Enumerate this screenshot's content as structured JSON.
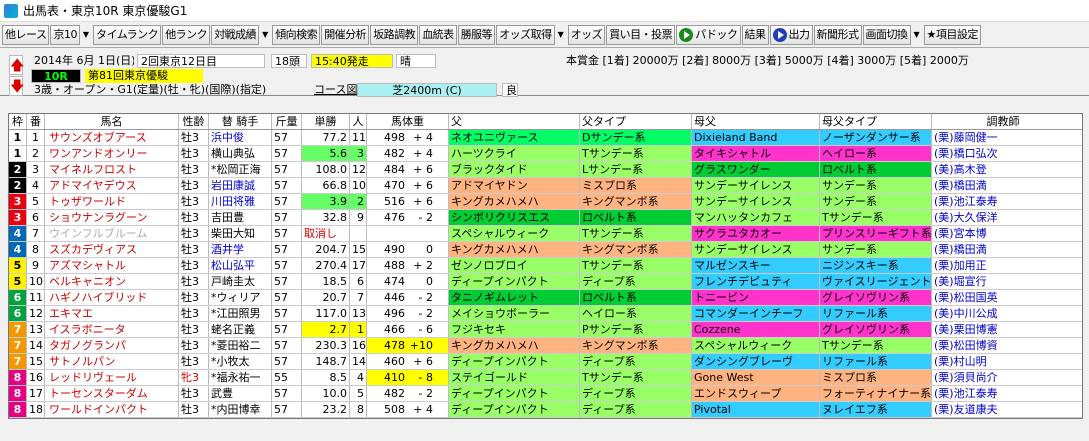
{
  "window": {
    "title": "出馬表・東京10R 東京優駿G1"
  },
  "toolbar": {
    "items": [
      "他レース",
      "京10",
      "タイムランク",
      "他ランク",
      "対戦成績",
      "傾向検索",
      "開催分析",
      "坂路調教",
      "血統表",
      "勝服等",
      "オッズ取得",
      "オッズ",
      "買い目・投票",
      "パドック",
      "結果",
      "出力",
      "新聞形式",
      "画面切換",
      "★項目設定"
    ]
  },
  "race": {
    "date": "2014年 6月 1日(日)",
    "kaisai": "2回東京12日目",
    "heads": "18頭",
    "time": "15:40発走",
    "weather": "晴",
    "race_no": "10R",
    "race_name": "第81回東京優駿",
    "conditions": "3歳・オープン・G1(定量)(牡・牝)(国際)(指定)",
    "course_label": "コース図",
    "course": "芝2400m (C)",
    "going": "良",
    "prize": "本賞金 [1着] 20000万 [2着] 8000万 [3着] 5000万 [4着] 3000万 [5着] 2000万"
  },
  "headers": {
    "waku": "枠",
    "ban": "番",
    "name": "馬名",
    "sex": "性齢",
    "jockey": "替 騎手",
    "weight": "斤量",
    "odds": "単勝",
    "pop": "人",
    "bw": "馬体重",
    "sire": "父",
    "stype": "父タイプ",
    "dam": "母父",
    "dtype": "母父タイプ",
    "trainer": "調教師"
  },
  "colors": {
    "waku1": "#ffffff",
    "waku2": "#000000",
    "waku3": "#e60012",
    "waku4": "#0068b7",
    "waku5": "#fff100",
    "waku6": "#00a33e",
    "waku7": "#f39800",
    "waku8": "#e5007f"
  },
  "horses": [
    {
      "waku": "1",
      "ban": "1",
      "name": "サウンズオブアース",
      "sex": "牡3",
      "jockey": "浜中俊",
      "weight": "57",
      "odds": "77.2",
      "pop": "11",
      "bw": "498",
      "bwd": "+ 4",
      "sire": "ネオユニヴァース",
      "stype": "Dサンデー系",
      "dam": "Dixieland Band",
      "dtype": "ノーザンダンサー系",
      "trainer": "(栗)藤岡健一"
    },
    {
      "waku": "1",
      "ban": "2",
      "name": "ワンアンドオンリー",
      "sex": "牡3",
      "jockey": "横山典弘",
      "weight": "57",
      "odds": "5.6",
      "pop": "3",
      "bw": "482",
      "bwd": "+ 4",
      "sire": "ハーツクライ",
      "stype": "Tサンデー系",
      "dam": "タイキシャトル",
      "dtype": "ヘイロー系",
      "trainer": "(栗)橋口弘次"
    },
    {
      "waku": "2",
      "ban": "3",
      "name": "マイネルフロスト",
      "sex": "牡3",
      "jockey": "*松岡正海",
      "weight": "57",
      "odds": "108.0",
      "pop": "12",
      "bw": "484",
      "bwd": "+ 6",
      "sire": "ブラックタイド",
      "stype": "Lサンデー系",
      "dam": "グラスワンダー",
      "dtype": "ロベルト系",
      "trainer": "(美)高木登"
    },
    {
      "waku": "2",
      "ban": "4",
      "name": "アドマイヤデウス",
      "sex": "牡3",
      "jockey": "岩田康誠",
      "weight": "57",
      "odds": "66.8",
      "pop": "10",
      "bw": "470",
      "bwd": "+ 6",
      "sire": "アドマイヤドン",
      "stype": "ミスプロ系",
      "dam": "サンデーサイレンス",
      "dtype": "サンデー系",
      "trainer": "(栗)橋田満"
    },
    {
      "waku": "3",
      "ban": "5",
      "name": "トゥザワールド",
      "sex": "牡3",
      "jockey": "川田将雅",
      "weight": "57",
      "odds": "3.9",
      "pop": "2",
      "bw": "516",
      "bwd": "+ 6",
      "sire": "キングカメハメハ",
      "stype": "キングマンボ系",
      "dam": "サンデーサイレンス",
      "dtype": "サンデー系",
      "trainer": "(栗)池江泰寿"
    },
    {
      "waku": "3",
      "ban": "6",
      "name": "ショウナンラグーン",
      "sex": "牡3",
      "jockey": "吉田豊",
      "weight": "57",
      "odds": "32.8",
      "pop": "9",
      "bw": "476",
      "bwd": "- 2",
      "sire": "シンボリクリスエス",
      "stype": "ロベルト系",
      "dam": "マンハッタンカフェ",
      "dtype": "Tサンデー系",
      "trainer": "(美)大久保洋"
    },
    {
      "waku": "4",
      "ban": "7",
      "name": "ウインフルブルーム",
      "sex": "牡3",
      "jockey": "柴田大知",
      "weight": "57",
      "odds": "取消し",
      "pop": "",
      "bw": "",
      "bwd": "",
      "sire": "スペシャルウィーク",
      "stype": "Tサンデー系",
      "dam": "サクラユタカオー",
      "dtype": "プリンスリーギフト系",
      "trainer": "(栗)宮本博"
    },
    {
      "waku": "4",
      "ban": "8",
      "name": "スズカデヴィアス",
      "sex": "牡3",
      "jockey": "酒井学",
      "weight": "57",
      "odds": "204.7",
      "pop": "15",
      "bw": "490",
      "bwd": "0",
      "sire": "キングカメハメハ",
      "stype": "キングマンボ系",
      "dam": "サンデーサイレンス",
      "dtype": "サンデー系",
      "trainer": "(栗)橋田満"
    },
    {
      "waku": "5",
      "ban": "9",
      "name": "アズマシャトル",
      "sex": "牡3",
      "jockey": "松山弘平",
      "weight": "57",
      "odds": "270.4",
      "pop": "17",
      "bw": "488",
      "bwd": "+ 2",
      "sire": "ゼンノロブロイ",
      "stype": "Tサンデー系",
      "dam": "マルゼンスキー",
      "dtype": "ニジンスキー系",
      "trainer": "(栗)加用正"
    },
    {
      "waku": "5",
      "ban": "10",
      "name": "ベルキャニオン",
      "sex": "牡3",
      "jockey": "戸崎圭太",
      "weight": "57",
      "odds": "18.5",
      "pop": "6",
      "bw": "474",
      "bwd": "0",
      "sire": "ディープインパクト",
      "stype": "ディープ系",
      "dam": "フレンチデピュティ",
      "dtype": "ヴァイスリージェント系",
      "trainer": "(美)堀宣行"
    },
    {
      "waku": "6",
      "ban": "11",
      "name": "ハギノハイブリッド",
      "sex": "牡3",
      "jockey": "*ウィリア",
      "weight": "57",
      "odds": "20.7",
      "pop": "7",
      "bw": "446",
      "bwd": "- 2",
      "sire": "タニノギムレット",
      "stype": "ロベルト系",
      "dam": "トニービン",
      "dtype": "グレイソヴリン系",
      "trainer": "(栗)松田国英"
    },
    {
      "waku": "6",
      "ban": "12",
      "name": "エキマエ",
      "sex": "牡3",
      "jockey": "*江田照男",
      "weight": "57",
      "odds": "117.0",
      "pop": "13",
      "bw": "496",
      "bwd": "- 2",
      "sire": "メイショウボーラー",
      "stype": "ヘイロー系",
      "dam": "コマンダーインチーフ",
      "dtype": "リファール系",
      "trainer": "(美)中川公成"
    },
    {
      "waku": "7",
      "ban": "13",
      "name": "イスラボニータ",
      "sex": "牡3",
      "jockey": "蛯名正義",
      "weight": "57",
      "odds": "2.7",
      "pop": "1",
      "bw": "466",
      "bwd": "- 6",
      "sire": "フジキセキ",
      "stype": "Pサンデー系",
      "dam": "Cozzene",
      "dtype": "グレイソヴリン系",
      "trainer": "(美)栗田博憲"
    },
    {
      "waku": "7",
      "ban": "14",
      "name": "タガノグランパ",
      "sex": "牡3",
      "jockey": "*菱田裕二",
      "weight": "57",
      "odds": "230.3",
      "pop": "16",
      "bw": "478",
      "bwd": "+10",
      "sire": "キングカメハメハ",
      "stype": "キングマンボ系",
      "dam": "スペシャルウィーク",
      "dtype": "Tサンデー系",
      "trainer": "(栗)松田博資"
    },
    {
      "waku": "7",
      "ban": "15",
      "name": "サトノルパン",
      "sex": "牡3",
      "jockey": "*小牧太",
      "weight": "57",
      "odds": "148.7",
      "pop": "14",
      "bw": "460",
      "bwd": "+ 6",
      "sire": "ディープインパクト",
      "stype": "ディープ系",
      "dam": "ダンシングブレーヴ",
      "dtype": "リファール系",
      "trainer": "(栗)村山明"
    },
    {
      "waku": "8",
      "ban": "16",
      "name": "レッドリヴェール",
      "sex": "牝3",
      "jockey": "*福永祐一",
      "weight": "55",
      "odds": "8.5",
      "pop": "4",
      "bw": "410",
      "bwd": "- 8",
      "sire": "ステイゴールド",
      "stype": "Tサンデー系",
      "dam": "Gone West",
      "dtype": "ミスプロ系",
      "trainer": "(栗)須貝尚介"
    },
    {
      "waku": "8",
      "ban": "17",
      "name": "トーセンスターダム",
      "sex": "牡3",
      "jockey": "武豊",
      "weight": "57",
      "odds": "10.0",
      "pop": "5",
      "bw": "482",
      "bwd": "- 2",
      "sire": "ディープインパクト",
      "stype": "ディープ系",
      "dam": "エンドスウィープ",
      "dtype": "フォーティナイナー系",
      "trainer": "(栗)池江泰寿"
    },
    {
      "waku": "8",
      "ban": "18",
      "name": "ワールドインパクト",
      "sex": "牡3",
      "jockey": "*内田博幸",
      "weight": "57",
      "odds": "23.2",
      "pop": "8",
      "bw": "508",
      "bwd": "+ 4",
      "sire": "ディープインパクト",
      "stype": "ディープ系",
      "dam": "Pivotal",
      "dtype": "ヌレイエフ系",
      "trainer": "(栗)友道康夫"
    }
  ]
}
